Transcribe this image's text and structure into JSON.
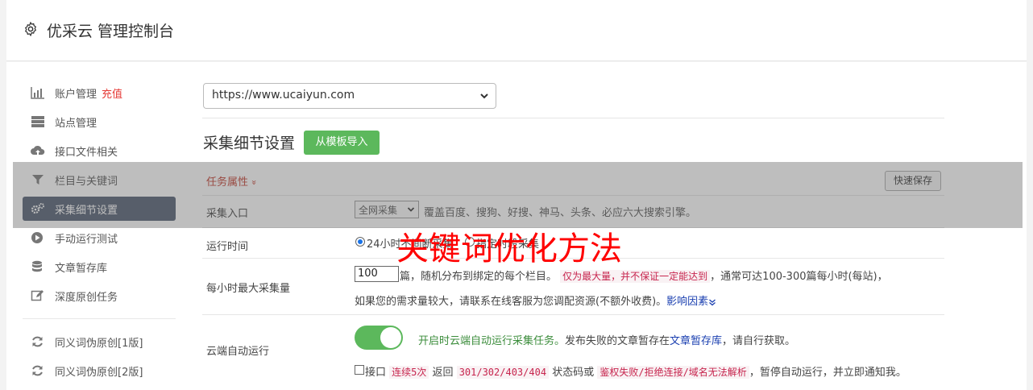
{
  "header": {
    "title": "优采云 管理控制台",
    "icon": "gear-icon"
  },
  "sidebar": {
    "items": [
      {
        "label": "账户管理",
        "extra": "充值",
        "icon": "bar-chart-icon"
      },
      {
        "label": "站点管理",
        "icon": "server-icon"
      },
      {
        "label": "接口文件相关",
        "icon": "cloud-upload-icon"
      },
      {
        "label": "栏目与关键词",
        "icon": "filter-icon"
      },
      {
        "label": "采集细节设置",
        "icon": "cogs-icon",
        "active": true
      },
      {
        "label": "手动运行测试",
        "icon": "play-circle-icon"
      },
      {
        "label": "文章暂存库",
        "icon": "database-icon"
      },
      {
        "label": "深度原创任务",
        "icon": "edit-icon"
      },
      {
        "label": "同义词伪原创[1版]",
        "icon": "refresh-icon"
      },
      {
        "label": "同义词伪原创[2版]",
        "icon": "refresh-icon"
      }
    ]
  },
  "main": {
    "site_select": "https://www.ucaiyun.com",
    "section_title": "采集细节设置",
    "import_button": "从模板导入",
    "task_attr": "任务属性",
    "task_attr_chevron": "»",
    "quick_save": "快速保存",
    "rows": {
      "collect_entry": {
        "label": "采集入口",
        "select": "全网采集",
        "desc": "覆盖百度、搜狗、好搜、神马、头条、必应六大搜索引擎。"
      },
      "run_time": {
        "label": "运行时间",
        "option1": "24小时",
        "option1_rest": "不间断采集",
        "option2_rest": "指定时段采集"
      },
      "max_per_hour": {
        "label": "每小时最大采集量",
        "value": "100",
        "text1": "篇，随机分布到绑定的每个栏目。",
        "code": "仅为最大量，并不保证一定能达到",
        "text2": "，通常可达100-300篇每小时(每站)，",
        "text3": "如果您的需求量较大，请联系在线客服为您调配资源(不额外收费)。",
        "link": "影响因素"
      },
      "cloud_auto": {
        "label": "云端自动运行",
        "green": "开启时云端自动运行采集任务。",
        "text1": "发布失败的文章暂存在",
        "link": "文章暂存库",
        "text2": "，请自行获取。",
        "cb_label": "接口",
        "code1": "连续5次",
        "text3": "返回",
        "code2": "301/302/403/404",
        "text4": "状态码或",
        "code3": "鉴权失败/拒绝连接/域名无法解析",
        "text5": "，暂停自动运行，并立即通知我。"
      }
    }
  },
  "watermark": "关键词优化方法"
}
